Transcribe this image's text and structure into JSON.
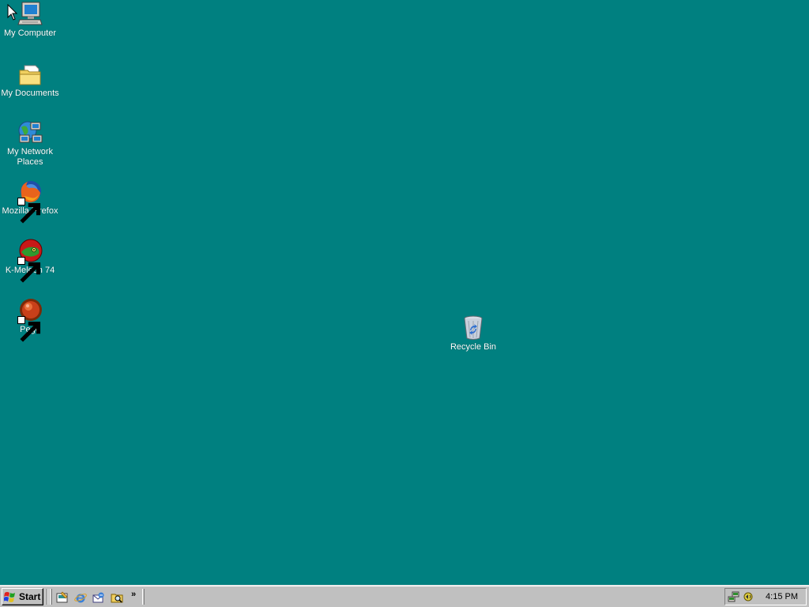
{
  "desktop": {
    "background": "#008080",
    "icons": [
      {
        "label": "My Computer",
        "icon": "my-computer-icon",
        "shortcut": false
      },
      {
        "label": "My Documents",
        "icon": "my-documents-icon",
        "shortcut": false
      },
      {
        "label": "My Network Places",
        "icon": "network-places-icon",
        "shortcut": false
      },
      {
        "label": "Mozilla Firefox",
        "icon": "firefox-icon",
        "shortcut": true
      },
      {
        "label": "K-Meleon 74",
        "icon": "k-meleon-icon",
        "shortcut": true
      },
      {
        "label": "Pego",
        "icon": "pego-icon",
        "shortcut": true
      },
      {
        "label": "Recycle Bin",
        "icon": "recycle-bin-icon",
        "shortcut": false
      }
    ]
  },
  "taskbar": {
    "start_label": "Start",
    "quick_launch": [
      "show-desktop-icon",
      "internet-explorer-icon",
      "outlook-express-icon",
      "windows-explorer-icon"
    ],
    "more_label": "»",
    "tray_icons": [
      "network-tray-icon",
      "volume-tray-icon"
    ],
    "clock": "4:15 PM"
  }
}
